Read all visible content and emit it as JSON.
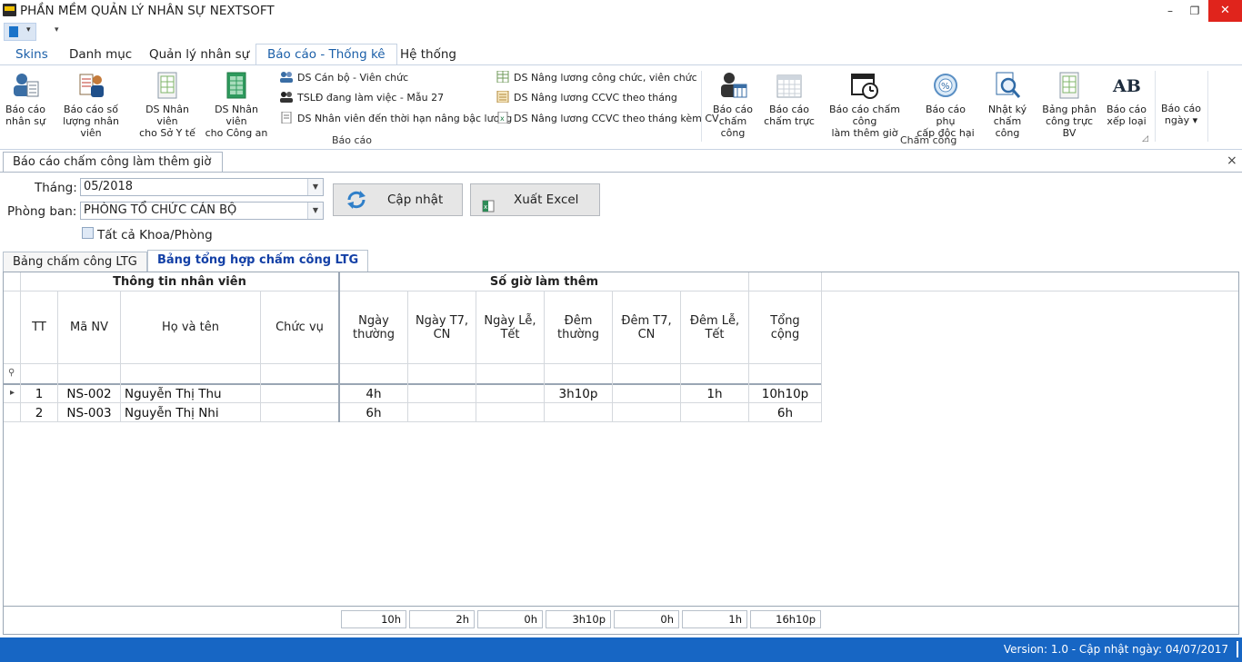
{
  "app": {
    "title": "PHẦN MỀM QUẢN LÝ NHÂN SỰ NEXTSOFT"
  },
  "window_controls": {
    "minimize": "–",
    "restore": "❐",
    "close": "✕"
  },
  "quick_access": {
    "more": "▾"
  },
  "ribbon_tabs": [
    "Skins",
    "Danh mục",
    "Quản lý nhân sự",
    "Báo cáo - Thống kê",
    "Hệ thống"
  ],
  "active_tab": "Báo cáo - Thống kê",
  "ribbon": {
    "bao_cao_group": {
      "label": "Báo cáo",
      "large": [
        {
          "l1": "Báo cáo",
          "l2": "nhân sự",
          "icon": "person-report-icon"
        },
        {
          "l1": "Báo cáo số",
          "l2": "lượng nhân viên",
          "icon": "staff-count-icon"
        },
        {
          "l1": "DS Nhân viên",
          "l2": "cho Sở Y tế",
          "icon": "spreadsheet-icon"
        },
        {
          "l1": "DS Nhân viên",
          "l2": "cho Công an",
          "icon": "spreadsheet-green-icon"
        }
      ],
      "small_col1": [
        "DS Cán bộ - Viên chức",
        "TSLĐ đang làm việc - Mẫu 27",
        "DS Nhân viên đến thời hạn nâng bậc lương"
      ],
      "small_col2": [
        "DS Nâng lương công chức, viên chức",
        "DS Nâng lương CCVC theo tháng",
        "DS Nâng lương CCVC theo tháng kèm CV"
      ]
    },
    "cham_cong_group": {
      "label": "Chấm công",
      "large": [
        {
          "l1": "Báo cáo",
          "l2": "chấm công",
          "icon": "person-calendar-icon"
        },
        {
          "l1": "Báo cáo",
          "l2": "chấm trực",
          "icon": "calendar-grid-icon"
        },
        {
          "l1": "Báo cáo chấm công",
          "l2": "làm thêm giờ",
          "icon": "calendar-clock-icon"
        },
        {
          "l1": "Báo cáo phụ",
          "l2": "cấp độc hại",
          "icon": "percent-badge-icon"
        },
        {
          "l1": "Nhật ký",
          "l2": "chấm công",
          "icon": "magnifier-doc-icon"
        },
        {
          "l1": "Bảng phân",
          "l2": "công trực BV",
          "icon": "spreadsheet-icon"
        },
        {
          "l1": "Báo cáo",
          "l2": "xếp loại",
          "icon": "ab-icon"
        }
      ]
    },
    "bao_cao_ngay": {
      "l1": "Báo cáo",
      "l2": "ngày",
      "arrow": "▾"
    }
  },
  "doc_tab": {
    "title": "Báo cáo chấm công làm thêm giờ",
    "close": "×"
  },
  "filters": {
    "thang_label": "Tháng:",
    "thang_value": "05/2018",
    "phongban_label": "Phòng ban:",
    "phongban_value": "PHÒNG TỔ CHỨC CÁN BỘ",
    "all_label": "Tất cả Khoa/Phòng",
    "update_button": "Cập nhật",
    "export_button": "Xuất Excel"
  },
  "inner_tabs": [
    "Bảng chấm công LTG",
    "Bảng tổng hợp chấm công LTG"
  ],
  "grid": {
    "band1": "Thông tin nhân viên",
    "band2": "Số giờ làm thêm",
    "columns": {
      "tt": "TT",
      "manv": "Mã NV",
      "hoten": "Họ và tên",
      "chucvu": "Chức vụ",
      "ngay_thuong": [
        "Ngày",
        "thường"
      ],
      "ngay_t7": [
        "Ngày T7,",
        "CN"
      ],
      "ngay_le": [
        "Ngày Lễ,",
        "Tết"
      ],
      "dem_thuong": [
        "Đêm",
        "thường"
      ],
      "dem_t7": [
        "Đêm T7,",
        "CN"
      ],
      "dem_le": [
        "Đêm Lễ,",
        "Tết"
      ],
      "tong": [
        "Tổng",
        "cộng"
      ]
    },
    "filter_row_icon": "⚲",
    "row_indicator": "▸",
    "rows": [
      {
        "tt": "1",
        "manv": "NS-002",
        "hoten": "Nguyễn Thị Thu",
        "chucvu": "",
        "ngay_thuong": "4h",
        "ngay_t7": "",
        "ngay_le": "",
        "dem_thuong": "3h10p",
        "dem_t7": "",
        "dem_le": "1h",
        "tong": "10h10p"
      },
      {
        "tt": "2",
        "manv": "NS-003",
        "hoten": "Nguyễn Thị Nhi",
        "chucvu": "",
        "ngay_thuong": "6h",
        "ngay_t7": "",
        "ngay_le": "",
        "dem_thuong": "",
        "dem_t7": "",
        "dem_le": "",
        "tong": "6h"
      }
    ],
    "footer": [
      "10h",
      "2h",
      "0h",
      "3h10p",
      "0h",
      "1h",
      "16h10p"
    ]
  },
  "status": {
    "text": "Version: 1.0 - Cập nhật ngày: 04/07/2017"
  },
  "colors": {
    "accent": "#1b5fa8",
    "statusbar": "#1766c4",
    "close": "#e0241c"
  }
}
